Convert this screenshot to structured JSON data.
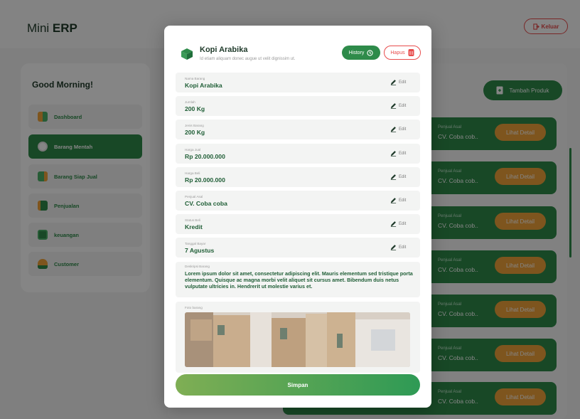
{
  "app": {
    "logo_light": "Mini ",
    "logo_bold": "ERP",
    "logout_label": "Keluar"
  },
  "sidebar": {
    "greeting": "Good Morning!",
    "items": [
      {
        "label": "Dashboard",
        "icon": "dashboard-icon"
      },
      {
        "label": "Barang Mentah",
        "icon": "raw-goods-icon",
        "active": true
      },
      {
        "label": "Barang Siap Jual",
        "icon": "ready-goods-icon"
      },
      {
        "label": "Penjualan",
        "icon": "sales-icon"
      },
      {
        "label": "keuangan",
        "icon": "finance-icon"
      },
      {
        "label": "Customer",
        "icon": "customer-icon"
      }
    ]
  },
  "main": {
    "add_button": "Tambah Produk",
    "rows": [
      {
        "seller_label": "Penjual Asal",
        "seller": "CV. Coba cob..",
        "detail": "Lihat Detail"
      },
      {
        "seller_label": "Penjual Asal",
        "seller": "CV. Coba cob..",
        "detail": "Lihat Detail"
      },
      {
        "seller_label": "Penjual Asal",
        "seller": "CV. Coba cob..",
        "detail": "Lihat Detail"
      },
      {
        "seller_label": "Penjual Asal",
        "seller": "CV. Coba cob..",
        "detail": "Lihat Detail"
      },
      {
        "seller_label": "Penjual Asal",
        "seller": "CV. Coba cob..",
        "detail": "Lihat Detail"
      },
      {
        "seller_label": "Penjual Asal",
        "seller": "CV. Coba cob..",
        "detail": "Lihat Detail"
      },
      {
        "seller_label": "Penjual Asal",
        "seller": "CV. Coba cob..",
        "detail": "Lihat Detail"
      }
    ]
  },
  "modal": {
    "title": "Kopi Arabika",
    "subtitle": "Id etiam aliquam donec augue ut velit dignissim ut.",
    "history_label": "History",
    "delete_label": "Hapus",
    "edit_label": "Edit",
    "fields": [
      {
        "label": "Nama Barang",
        "value": "Kopi Arabika"
      },
      {
        "label": "Jumlah",
        "value": "200 Kg"
      },
      {
        "label": "Jenis Barang",
        "value": "200 Kg"
      },
      {
        "label": "Harga Jual",
        "value": "Rp 20.000.000"
      },
      {
        "label": "Harga Beli",
        "value": "Rp 20.000.000"
      },
      {
        "label": "Penjual Asal",
        "value": "CV. Coba coba"
      },
      {
        "label": "Status Beli",
        "value": "Kredit"
      },
      {
        "label": "Tanggal Bayar",
        "value": "7 Agustus"
      }
    ],
    "description_label": "Deskripsi Barang",
    "description": "Lorem ipsum dolor sit amet, consectetur adipiscing elit. Mauris elementum sed tristique porta elementum. Quisque ac magna morbi velit aliquet sit cursus amet. Bibendum duis netus vulputate ultricies in. Hendrerit ut molestie varius et.",
    "photo_label": "Foto barang",
    "save_label": "Simpan"
  },
  "colors": {
    "primary": "#2e8b4a",
    "accent": "#f2a33a",
    "danger": "#e84c4c"
  }
}
